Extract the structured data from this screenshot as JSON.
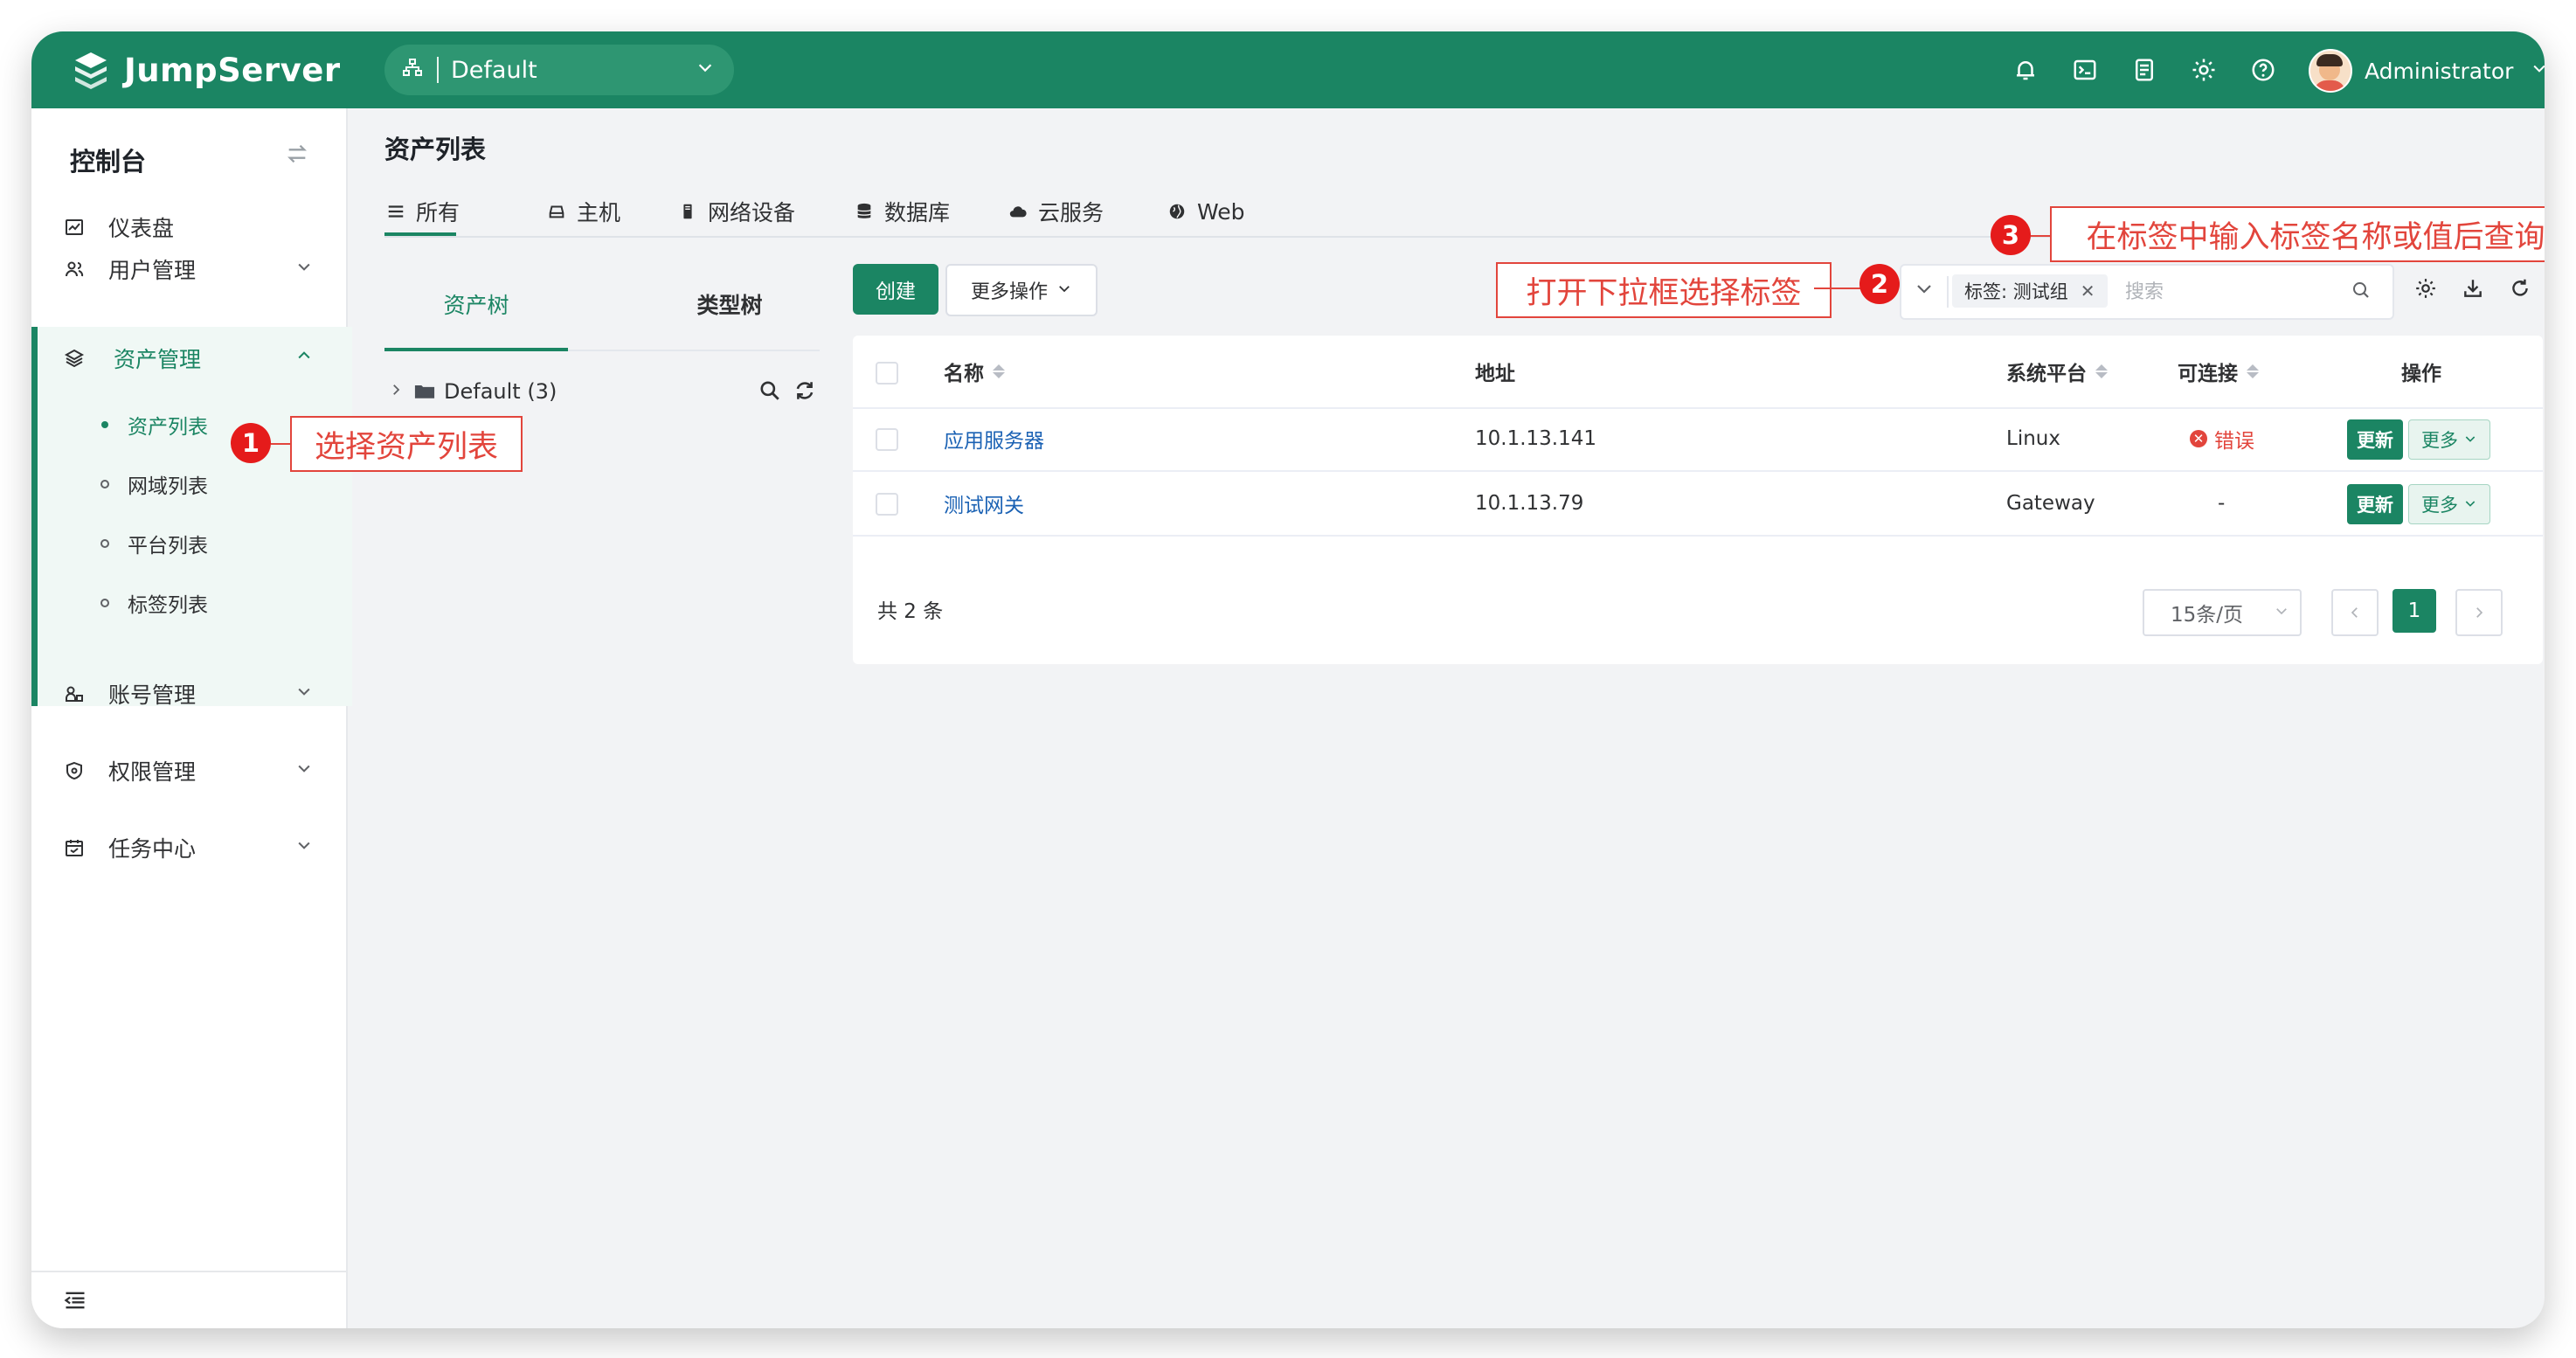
{
  "topbar": {
    "brand": "JumpServer",
    "org_value": "Default",
    "user_name": "Administrator"
  },
  "sidebar": {
    "title": "控制台",
    "items": [
      {
        "label": "仪表盘"
      },
      {
        "label": "用户管理"
      },
      {
        "label": "资产管理"
      },
      {
        "label": "账号管理"
      },
      {
        "label": "权限管理"
      },
      {
        "label": "任务中心"
      }
    ],
    "submenu": [
      {
        "label": "资产列表"
      },
      {
        "label": "网域列表"
      },
      {
        "label": "平台列表"
      },
      {
        "label": "标签列表"
      }
    ]
  },
  "page": {
    "title": "资产列表",
    "tabs": [
      {
        "label": "所有"
      },
      {
        "label": "主机"
      },
      {
        "label": "网络设备"
      },
      {
        "label": "数据库"
      },
      {
        "label": "云服务"
      },
      {
        "label": "Web"
      }
    ]
  },
  "tree": {
    "tabs": [
      {
        "label": "资产树"
      },
      {
        "label": "类型树"
      }
    ],
    "node_label": "Default (3)"
  },
  "toolbar": {
    "create_label": "创建",
    "more_ops_label": "更多操作",
    "tag_chip": "标签: 测试组",
    "search_placeholder": "搜索"
  },
  "table": {
    "columns": [
      "名称",
      "地址",
      "系统平台",
      "可连接",
      "操作"
    ],
    "rows": [
      {
        "name": "应用服务器",
        "address": "10.1.13.141",
        "platform": "Linux",
        "connectivity": "错误",
        "update": "更新",
        "more": "更多"
      },
      {
        "name": "测试网关",
        "address": "10.1.13.79",
        "platform": "Gateway",
        "connectivity": "-",
        "update": "更新",
        "more": "更多"
      }
    ],
    "total": "共 2 条",
    "page_size": "15条/页",
    "current_page": "1"
  },
  "annotations": [
    {
      "number": "1",
      "text": "选择资产列表"
    },
    {
      "number": "2",
      "text": "打开下拉框选择标签"
    },
    {
      "number": "3",
      "text": "在标签中输入标签名称或值后查询"
    }
  ],
  "colors": {
    "brand": "#1b8563",
    "link": "#1b62b4",
    "error": "#e2453c"
  }
}
